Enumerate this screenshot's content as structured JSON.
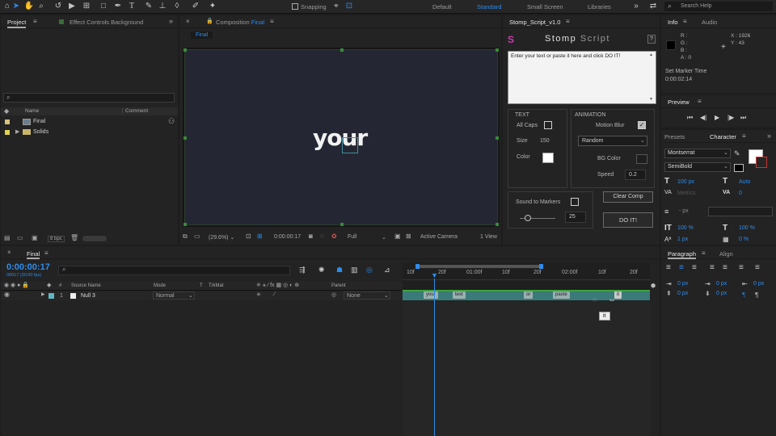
{
  "toolbar": {
    "snapping_label": "Snapping",
    "workspaces": [
      "Default",
      "Standard",
      "Small Screen",
      "Libraries"
    ],
    "active_workspace": "Standard",
    "search_placeholder": "Search Help"
  },
  "project_panel": {
    "tab_project": "Project",
    "tab_effect_controls": "Effect Controls Background",
    "columns": {
      "name": "Name",
      "comment": "Comment"
    },
    "items": [
      {
        "name": "Final",
        "color": "#d9c27a"
      },
      {
        "name": "Solids",
        "color": "#e0d34a"
      }
    ],
    "bpc": "8 bpc"
  },
  "composition": {
    "tab_prefix": "Composition",
    "tab_name": "Final",
    "breadcrumb": "Final",
    "canvas_text": "your",
    "zoom": "(29.6%)",
    "timecode": "0:00:00:17",
    "resolution": "Full",
    "camera": "Active Camera",
    "views": "1 View"
  },
  "stomp": {
    "tab": "Stomp_Script_v1.0",
    "title_bold": "Stomp",
    "title_light": "Script",
    "help_btn": "?",
    "textarea": "Enter your text or paste it here and click DO IT!",
    "text_section": "TEXT",
    "all_caps": "All Caps",
    "size_label": "Size",
    "size_value": "150",
    "color_label": "Color",
    "animation_section": "ANIMATION",
    "motion_blur": "Motion Blur",
    "mode": "Random",
    "bg_color": "BG Color",
    "speed_label": "Speed",
    "speed_value": "0.2",
    "sound_label": "Sound to Markers",
    "clear_btn": "Clear Comp",
    "slider_value": "25",
    "doit_btn": "DO IT!"
  },
  "info": {
    "tab_info": "Info",
    "tab_audio": "Audio",
    "r": "R :",
    "g": "G :",
    "b": "B :",
    "a": "A : 0",
    "x": "X : 1926",
    "y": "Y : 43",
    "marker_label": "Set Marker Time",
    "marker_time": "0:00:02:14"
  },
  "preview": {
    "tab": "Preview"
  },
  "character": {
    "tab_presets": "Presets",
    "tab_character": "Character",
    "font": "Montserrat",
    "style": "SemiBold",
    "size": "100 px",
    "leading": "Auto",
    "kerning": "Metrics",
    "tracking": "0",
    "stroke": "- px",
    "vscale": "100 %",
    "hscale": "100 %",
    "baseline": "1 px",
    "tsume": "0 %"
  },
  "paragraph": {
    "tab_paragraph": "Paragraph",
    "tab_align": "Align",
    "indent_left": "0 px",
    "indent_first": "0 px",
    "indent_right": "0 px",
    "space_before": "0 px",
    "space_after": "0 px"
  },
  "timeline": {
    "tab": "Final",
    "timecode": "0:00:00:17",
    "fps": "00017 (30.00 fps)",
    "headers": {
      "num": "#",
      "source": "Source Name",
      "mode": "Mode",
      "t": "T",
      "trkmat": "TrkMat",
      "parent": "Parent"
    },
    "layer": {
      "num": "1",
      "name": "Null 3",
      "mode": "Normal",
      "parent": "None"
    },
    "ticks": [
      "10f",
      "20f",
      "01:00f",
      "10f",
      "20f",
      "02:00f",
      "10f",
      "20f"
    ],
    "markers": [
      "your",
      "text",
      "or",
      "paste",
      "it"
    ],
    "tooltip": "it"
  },
  "colors": {
    "accent": "#2d8ceb",
    "layer_bar": "#3a7a78",
    "green": "#3fa33f"
  }
}
